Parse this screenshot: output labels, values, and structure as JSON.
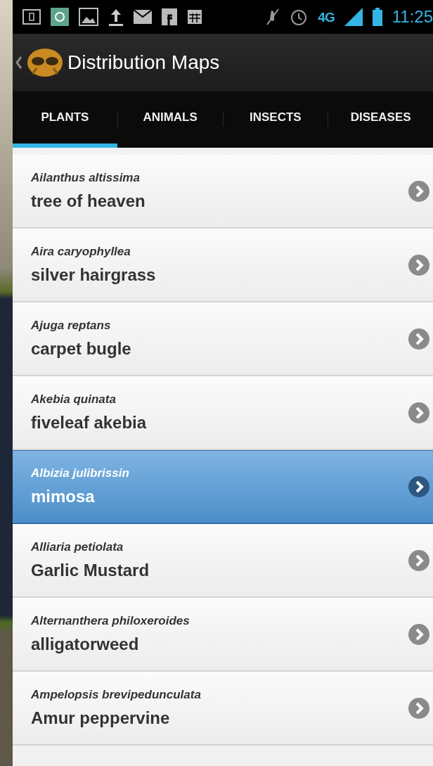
{
  "status_bar": {
    "network": "4G",
    "time": "11:25"
  },
  "action_bar": {
    "title": "Distribution Maps"
  },
  "tabs": [
    {
      "label": "PLANTS",
      "selected": true
    },
    {
      "label": "ANIMALS",
      "selected": false
    },
    {
      "label": "INSECTS",
      "selected": false
    },
    {
      "label": "DISEASES",
      "selected": false
    }
  ],
  "items": [
    {
      "scientific_name": "Ailanthus altissima",
      "common_name": "tree of heaven",
      "selected": false
    },
    {
      "scientific_name": "Aira caryophyllea",
      "common_name": "silver hairgrass",
      "selected": false
    },
    {
      "scientific_name": "Ajuga reptans",
      "common_name": "carpet bugle",
      "selected": false
    },
    {
      "scientific_name": "Akebia quinata",
      "common_name": "fiveleaf akebia",
      "selected": false
    },
    {
      "scientific_name": "Albizia julibrissin",
      "common_name": "mimosa",
      "selected": true
    },
    {
      "scientific_name": "Alliaria petiolata",
      "common_name": "Garlic Mustard",
      "selected": false
    },
    {
      "scientific_name": "Alternanthera philoxeroides",
      "common_name": "alligatorweed",
      "selected": false
    },
    {
      "scientific_name": "Ampelopsis brevipedunculata",
      "common_name": "Amur peppervine",
      "selected": false
    }
  ]
}
